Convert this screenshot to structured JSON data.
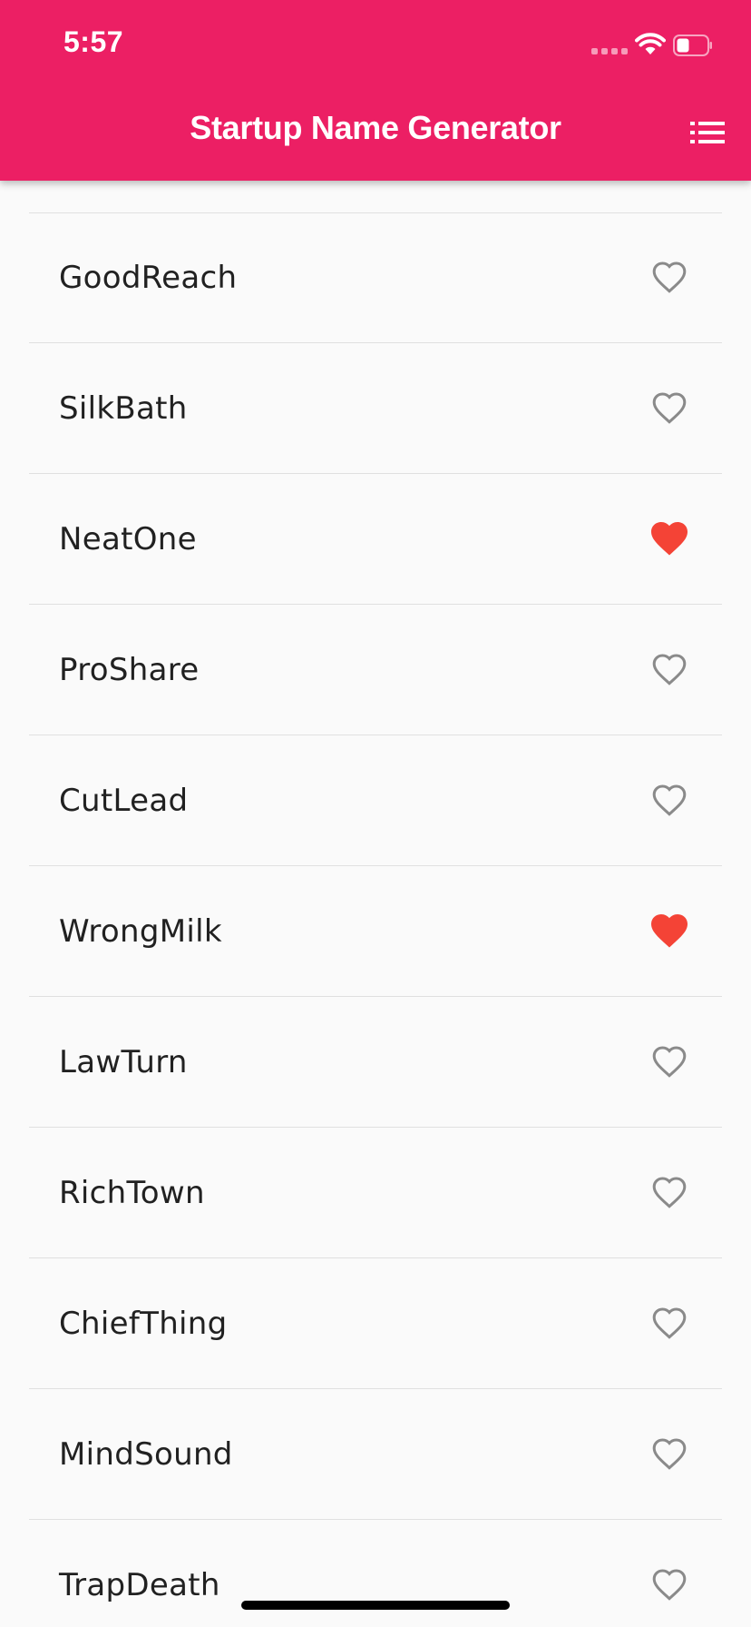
{
  "status_bar": {
    "time": "5:57"
  },
  "app_bar": {
    "title": "Startup Name Generator",
    "action_icon": "list-icon"
  },
  "colors": {
    "primary": "#ec1f64",
    "favorite": "#f44336",
    "not_favorite": "#8a8a8a",
    "text": "#212121",
    "background": "#fafafa"
  },
  "list": {
    "items": [
      {
        "name": "GoodReach",
        "favorite": false
      },
      {
        "name": "SilkBath",
        "favorite": false
      },
      {
        "name": "NeatOne",
        "favorite": true
      },
      {
        "name": "ProShare",
        "favorite": false
      },
      {
        "name": "CutLead",
        "favorite": false
      },
      {
        "name": "WrongMilk",
        "favorite": true
      },
      {
        "name": "LawTurn",
        "favorite": false
      },
      {
        "name": "RichTown",
        "favorite": false
      },
      {
        "name": "ChiefThing",
        "favorite": false
      },
      {
        "name": "MindSound",
        "favorite": false
      },
      {
        "name": "TrapDeath",
        "favorite": false
      }
    ]
  }
}
